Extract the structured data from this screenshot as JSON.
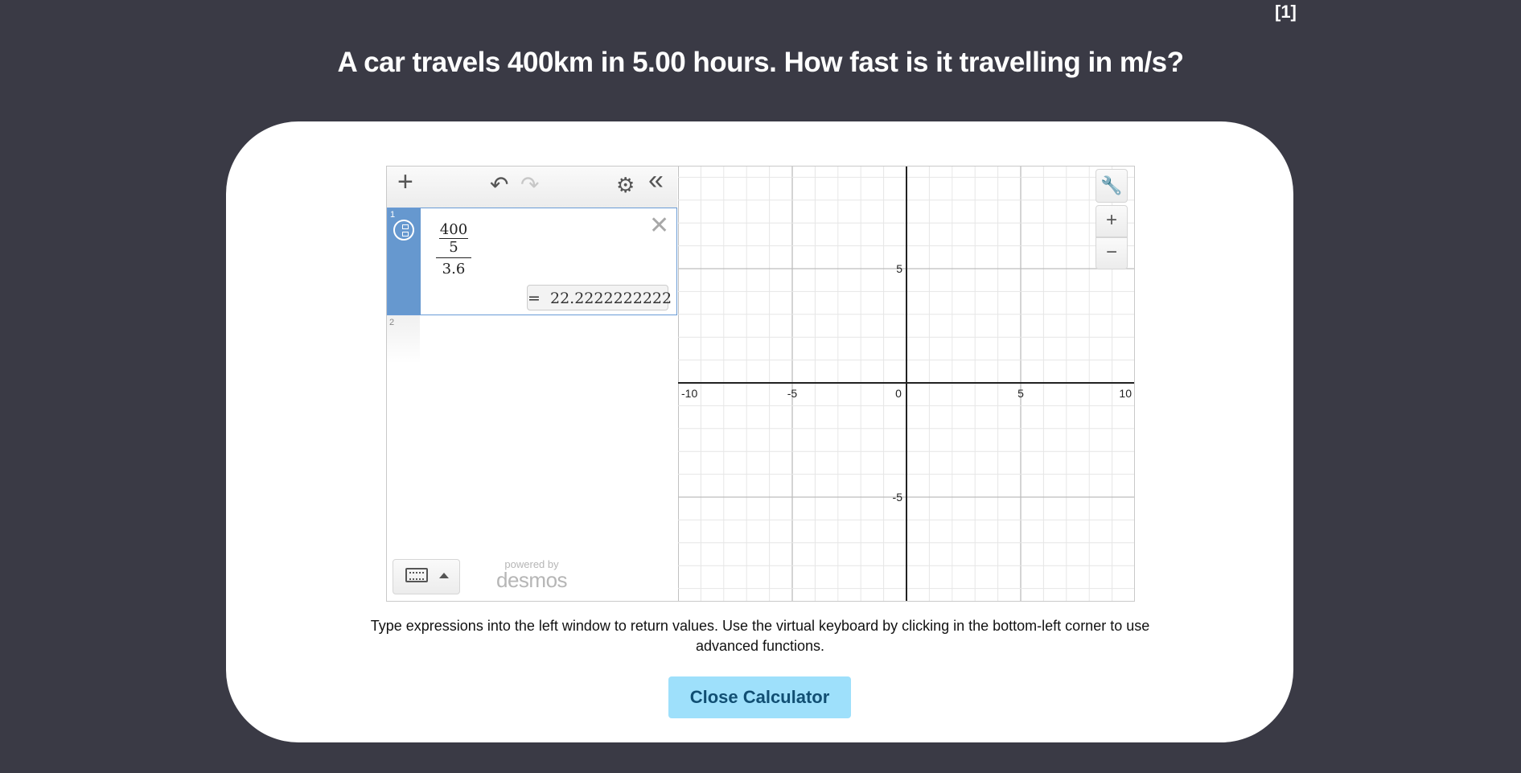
{
  "header": {
    "marks": "[1]",
    "question": "A car travels 400km in 5.00 hours. How fast is it travelling in m/s?"
  },
  "calculator": {
    "toolbar": {
      "add_icon": "plus-icon",
      "undo_icon": "undo-icon",
      "redo_icon": "redo-icon",
      "settings_icon": "gear-icon",
      "collapse_icon": "double-chevron-left-icon"
    },
    "expressions": [
      {
        "index": "1",
        "numerator_top": "400",
        "numerator_bottom": "5",
        "denominator": "3.6",
        "result": "22.2222222222"
      },
      {
        "index": "2"
      }
    ],
    "powered_by": "powered by",
    "brand": "desmos",
    "graph": {
      "x_ticks": [
        "-10",
        "-5",
        "0",
        "5",
        "10"
      ],
      "y_ticks": [
        "5",
        "-5"
      ],
      "xlim": [
        -10,
        10
      ],
      "ylim": [
        -9.5,
        9.5
      ]
    }
  },
  "hint": "Type expressions into the left window to return values. Use the virtual keyboard by clicking in the bottom-left corner to use advanced functions.",
  "close_button": "Close Calculator"
}
